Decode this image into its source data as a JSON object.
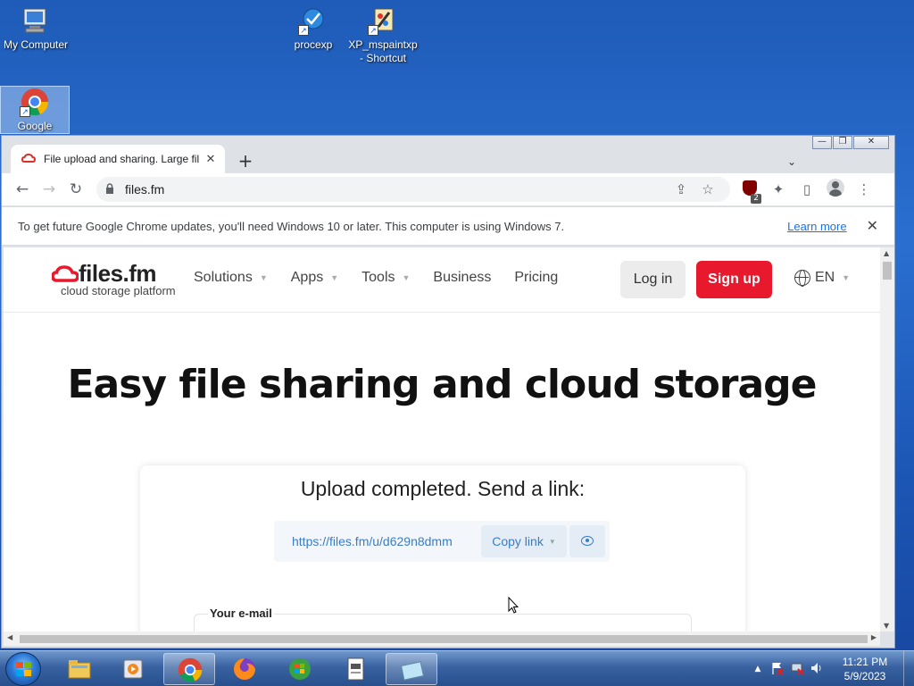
{
  "desktop": {
    "icons": [
      {
        "label": "My Computer"
      },
      {
        "label": "procexp"
      },
      {
        "label": "XP_mspaintxp - Shortcut"
      },
      {
        "label": "Google"
      }
    ]
  },
  "browser": {
    "tab": {
      "title": "File upload and sharing. Large fil",
      "close": "✕"
    },
    "new_tab": "+",
    "tab_search": "⌄",
    "window_controls": {
      "minimize": "—",
      "restore": "❐",
      "close": "✕"
    },
    "nav": {
      "back": "←",
      "forward": "→",
      "reload": "↻"
    },
    "omnibox": {
      "url": "files.fm",
      "lock": "🔒",
      "share": "⇪",
      "star": "☆"
    },
    "extensions": {
      "ublock_badge": "2",
      "puzzle": "✦",
      "sidepanel": "▯",
      "menu": "⋮"
    },
    "infobar": {
      "message": "To get future Google Chrome updates, you'll need Windows 10 or later. This computer is using Windows 7.",
      "link": "Learn more",
      "close": "✕"
    }
  },
  "site": {
    "logo": {
      "main": "files.fm",
      "sub": "cloud storage platform"
    },
    "menu": [
      {
        "label": "Solutions",
        "dropdown": true
      },
      {
        "label": "Apps",
        "dropdown": true
      },
      {
        "label": "Tools",
        "dropdown": true
      },
      {
        "label": "Business",
        "dropdown": false
      },
      {
        "label": "Pricing",
        "dropdown": false
      }
    ],
    "login": "Log in",
    "signup": "Sign up",
    "language": "EN",
    "hero_title": "Easy file sharing and cloud storage",
    "upload_card": {
      "title": "Upload completed. Send a link:",
      "link": "https://files.fm/u/d629n8dmm",
      "copy_label": "Copy link",
      "email_label": "Your e-mail"
    },
    "colors": {
      "brand_red": "#e8192c",
      "link_blue": "#3a7dc4"
    }
  },
  "taskbar": {
    "apps": [
      "explorer",
      "media-player",
      "chrome",
      "firefox",
      "windows-update",
      "mspaint-doc",
      "notepad"
    ],
    "clock": {
      "time": "11:21 PM",
      "date": "5/9/2023"
    },
    "tray": {
      "show_hidden": "▲"
    }
  }
}
